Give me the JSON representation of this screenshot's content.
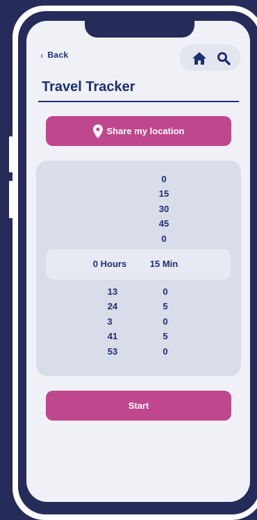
{
  "header": {
    "back_label": "Back",
    "title": "Travel Tracker",
    "icons": [
      "home-icon",
      "search-icon"
    ]
  },
  "share_button": {
    "label": "Share my location",
    "icon": "map-pin-icon"
  },
  "picker": {
    "selected": {
      "hours": "0 Hours",
      "minutes": "15 Min"
    },
    "minutes_above": [
      "0",
      "15",
      "30",
      "45",
      "0"
    ],
    "hours_below": [
      "13",
      "24",
      "3",
      "41",
      "53"
    ],
    "minutes_below": [
      "0",
      "5",
      "0",
      "5",
      "0"
    ]
  },
  "start_button": {
    "label": "Start"
  },
  "colors": {
    "background": "#252c5a",
    "screen": "#eff1f7",
    "accent": "#bf478d",
    "text": "#1c2f76",
    "picker_bg": "#d9dce9"
  }
}
